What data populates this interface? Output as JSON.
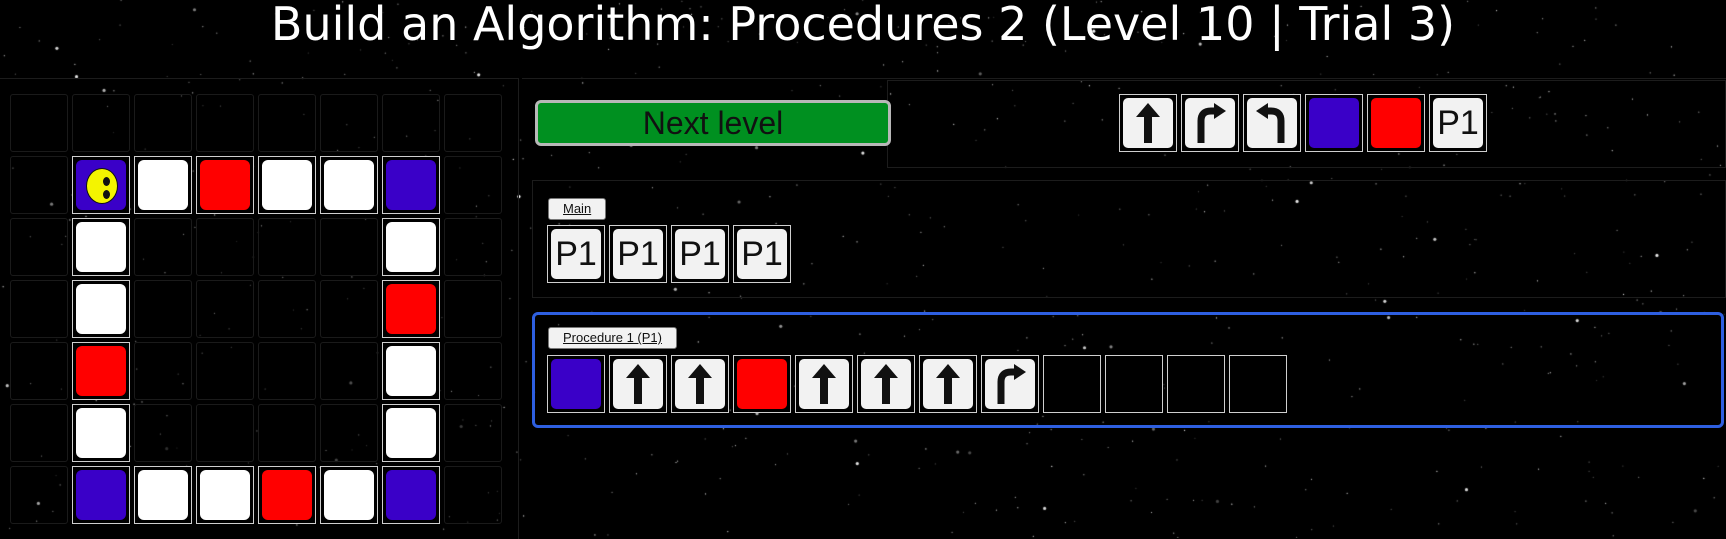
{
  "page": {
    "title": "Build an Algorithm: Procedures 2 (Level 10 | Trial 3)"
  },
  "controls": {
    "next_level_label": "Next level"
  },
  "colors": {
    "white_tile": "#ffffff",
    "red_tile": "#ff0000",
    "purple_tile": "#3a00c8",
    "robot": "#f4f400",
    "next_button": "#009020",
    "procedure_border": "#2e5fe0"
  },
  "palette": {
    "commands": [
      {
        "type": "forward-arrow",
        "label": ""
      },
      {
        "type": "turn-right-arrow",
        "label": ""
      },
      {
        "type": "turn-left-arrow",
        "label": ""
      },
      {
        "type": "purple-color",
        "label": ""
      },
      {
        "type": "red-color",
        "label": ""
      },
      {
        "type": "procedure",
        "label": "P1"
      }
    ]
  },
  "main": {
    "tab_label": "Main",
    "commands": [
      "P1",
      "P1",
      "P1",
      "P1"
    ]
  },
  "procedure1": {
    "tab_label": "Procedure 1 (P1)",
    "commands": [
      "purple-color",
      "forward-arrow",
      "forward-arrow",
      "red-color",
      "forward-arrow",
      "forward-arrow",
      "forward-arrow",
      "turn-right-arrow",
      "",
      "",
      "",
      ""
    ]
  },
  "board": {
    "columns": 8,
    "rows": 7,
    "robot": {
      "col": 1,
      "row": 1,
      "facing": "right"
    },
    "tiles": [
      "........",
      ".PWRWWP.",
      ".W....W.",
      ".W....R.",
      ".R....W.",
      ".W....W.",
      ".PWWRWP."
    ]
  }
}
